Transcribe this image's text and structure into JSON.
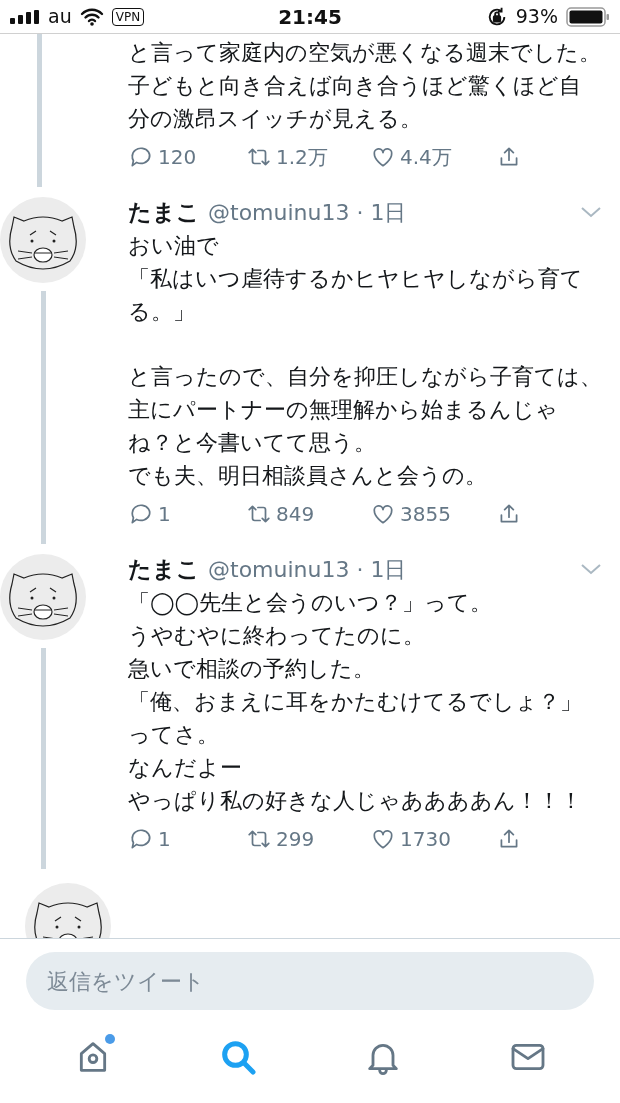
{
  "status_bar": {
    "carrier": "au",
    "vpn": "VPN",
    "time": "21:45",
    "battery": "93%"
  },
  "tweets": [
    {
      "kind": "continuation",
      "paragraphs": [
        [
          "と言って家庭内の空気が悪くなる週末でした。",
          "子どもと向き合えば向き合うほど驚くほど自分の激昂スイッチが見える。"
        ]
      ],
      "replies": "120",
      "retweets": "1.2万",
      "likes": "4.4万"
    },
    {
      "kind": "tweet",
      "name": "たまこ",
      "meta": "@tomuinu13 · 1日",
      "paragraphs": [
        [
          "おい油で",
          "「私はいつ虐待するかヒヤヒヤしながら育てる。」"
        ],
        [
          "と言ったので、自分を抑圧しながら子育ては、主にパートナーの無理解から始まるんじゃね？と今書いてて思う。",
          "でも夫、明日相談員さんと会うの。"
        ]
      ],
      "replies": "1",
      "retweets": "849",
      "likes": "3855"
    },
    {
      "kind": "tweet",
      "name": "たまこ",
      "meta": "@tomuinu13 · 1日",
      "paragraphs": [
        [
          "「◯◯先生と会うのいつ？」って。",
          "うやむやに終わってたのに。",
          "急いで相談の予約した。",
          "「俺、おまえに耳をかたむけてるでしょ？」",
          "ってさ。",
          "なんだよー",
          "やっぱり私の好きな人じゃああああん！！！"
        ]
      ],
      "replies": "1",
      "retweets": "299",
      "likes": "1730"
    },
    {
      "kind": "partial"
    }
  ],
  "reply_field": {
    "placeholder": "返信をツイート"
  },
  "nav": [
    {
      "kind": "home",
      "selected": false,
      "badge": true
    },
    {
      "kind": "search",
      "selected": true,
      "badge": false
    },
    {
      "kind": "bell",
      "selected": false,
      "badge": false
    },
    {
      "kind": "mail",
      "selected": false,
      "badge": false
    }
  ]
}
